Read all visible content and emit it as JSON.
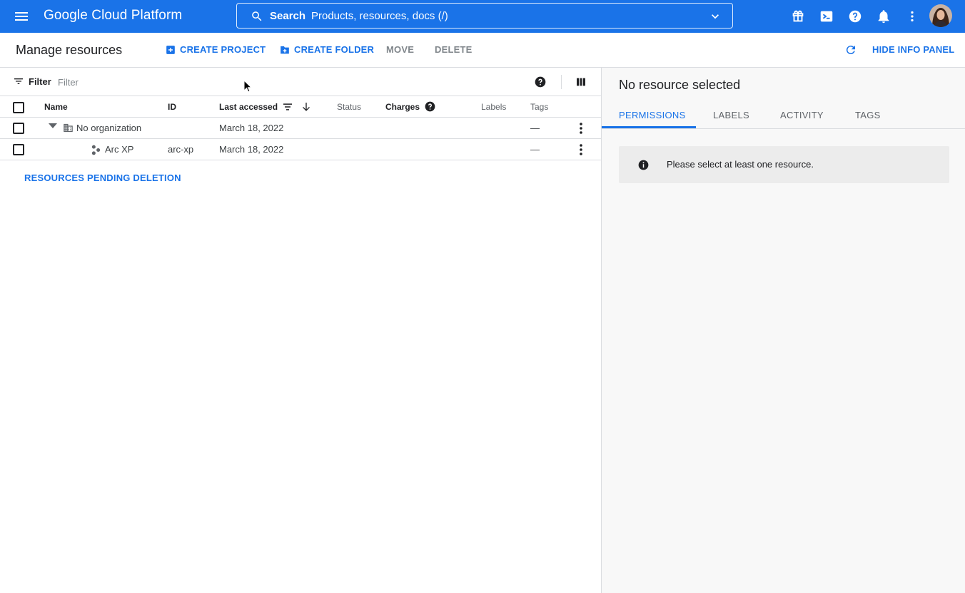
{
  "topbar": {
    "brand": "Google Cloud Platform",
    "search": {
      "label": "Search",
      "placeholder": "Products, resources, docs (/)"
    },
    "icons": [
      "gift-icon",
      "cloud-shell-icon",
      "help-icon",
      "notifications-icon",
      "more-vert-icon",
      "account-avatar"
    ],
    "accent": "#1a73e8"
  },
  "actionbar": {
    "title": "Manage resources",
    "create_project": "CREATE PROJECT",
    "create_folder": "CREATE FOLDER",
    "move": "MOVE",
    "delete": "DELETE",
    "hide_info": "HIDE INFO PANEL"
  },
  "filterbar": {
    "label": "Filter",
    "placeholder": "Filter"
  },
  "table": {
    "columns": {
      "name": "Name",
      "id": "ID",
      "last_accessed": "Last accessed",
      "status": "Status",
      "charges": "Charges",
      "labels": "Labels",
      "tags": "Tags"
    },
    "rows": [
      {
        "name": "No organization",
        "id": "",
        "last_accessed": "March 18, 2022",
        "tags": "—"
      },
      {
        "name": "Arc XP",
        "id": "arc-xp",
        "last_accessed": "March 18, 2022",
        "tags": "—"
      }
    ],
    "pending_link": "RESOURCES PENDING DELETION"
  },
  "info_panel": {
    "title": "No resource selected",
    "tabs": [
      "PERMISSIONS",
      "LABELS",
      "ACTIVITY",
      "TAGS"
    ],
    "active_tab": "PERMISSIONS",
    "notice": "Please select at least one resource."
  }
}
